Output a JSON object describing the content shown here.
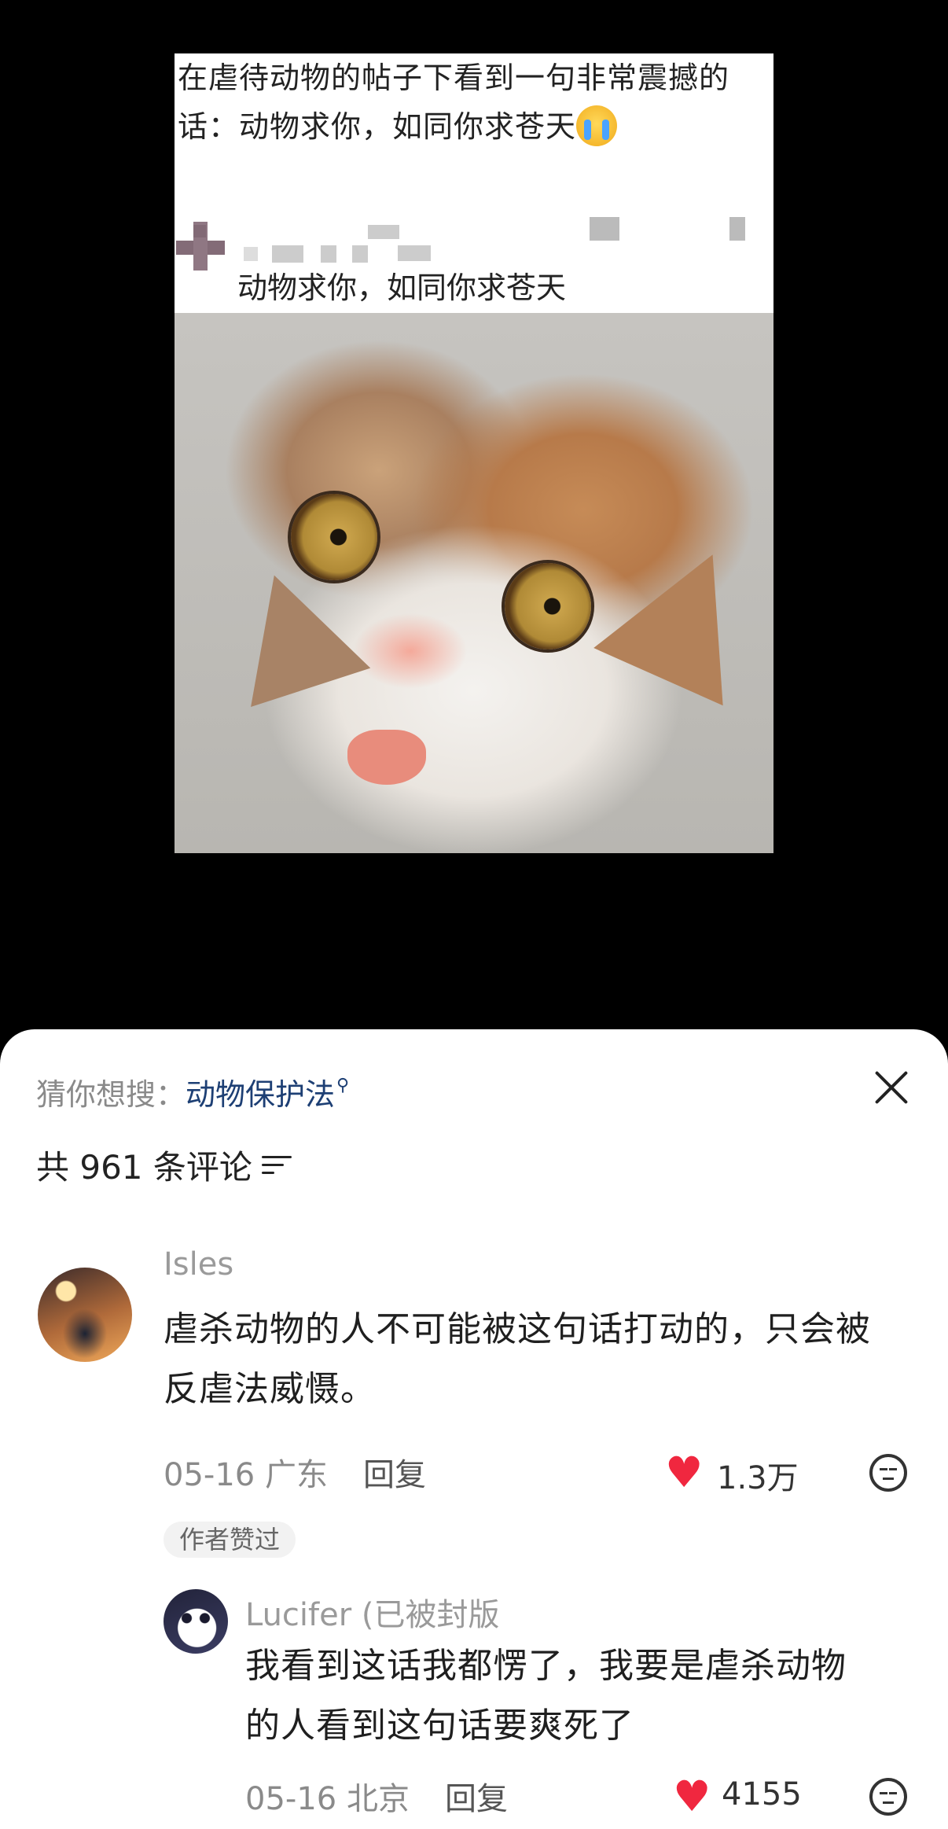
{
  "post": {
    "text_line1": "在虐待动物的帖子下看到一句非常震撼的",
    "text_line2": "话：动物求你，如同你求苍天",
    "emoji": "crying-face-emoji",
    "quote_text": "动物求你，如同你求苍天",
    "image": "calico-cat-photo"
  },
  "sheet": {
    "search_hint_label": "猜你想搜：",
    "search_term": "动物保护法",
    "comment_count_text": "共 961 条评论"
  },
  "comments": [
    {
      "username": "Isles",
      "text_line1": "虐杀动物的人不可能被这句话打动的，只会被",
      "text_line2": "反虐法威慑。",
      "date_location": "05-16 广东",
      "reply_label": "回复",
      "likes": "1.3万",
      "badge": "作者赞过"
    },
    {
      "username": "Lucifer (已被封版",
      "text_line1": "我看到这话我都愣了，我要是虐杀动物",
      "text_line2": "的人看到这句话要爽死了",
      "date_location": "05-16 北京",
      "reply_label": "回复",
      "likes": "4155"
    }
  ],
  "colors": {
    "like": "#f0273f",
    "search_term": "#1d3f74"
  }
}
